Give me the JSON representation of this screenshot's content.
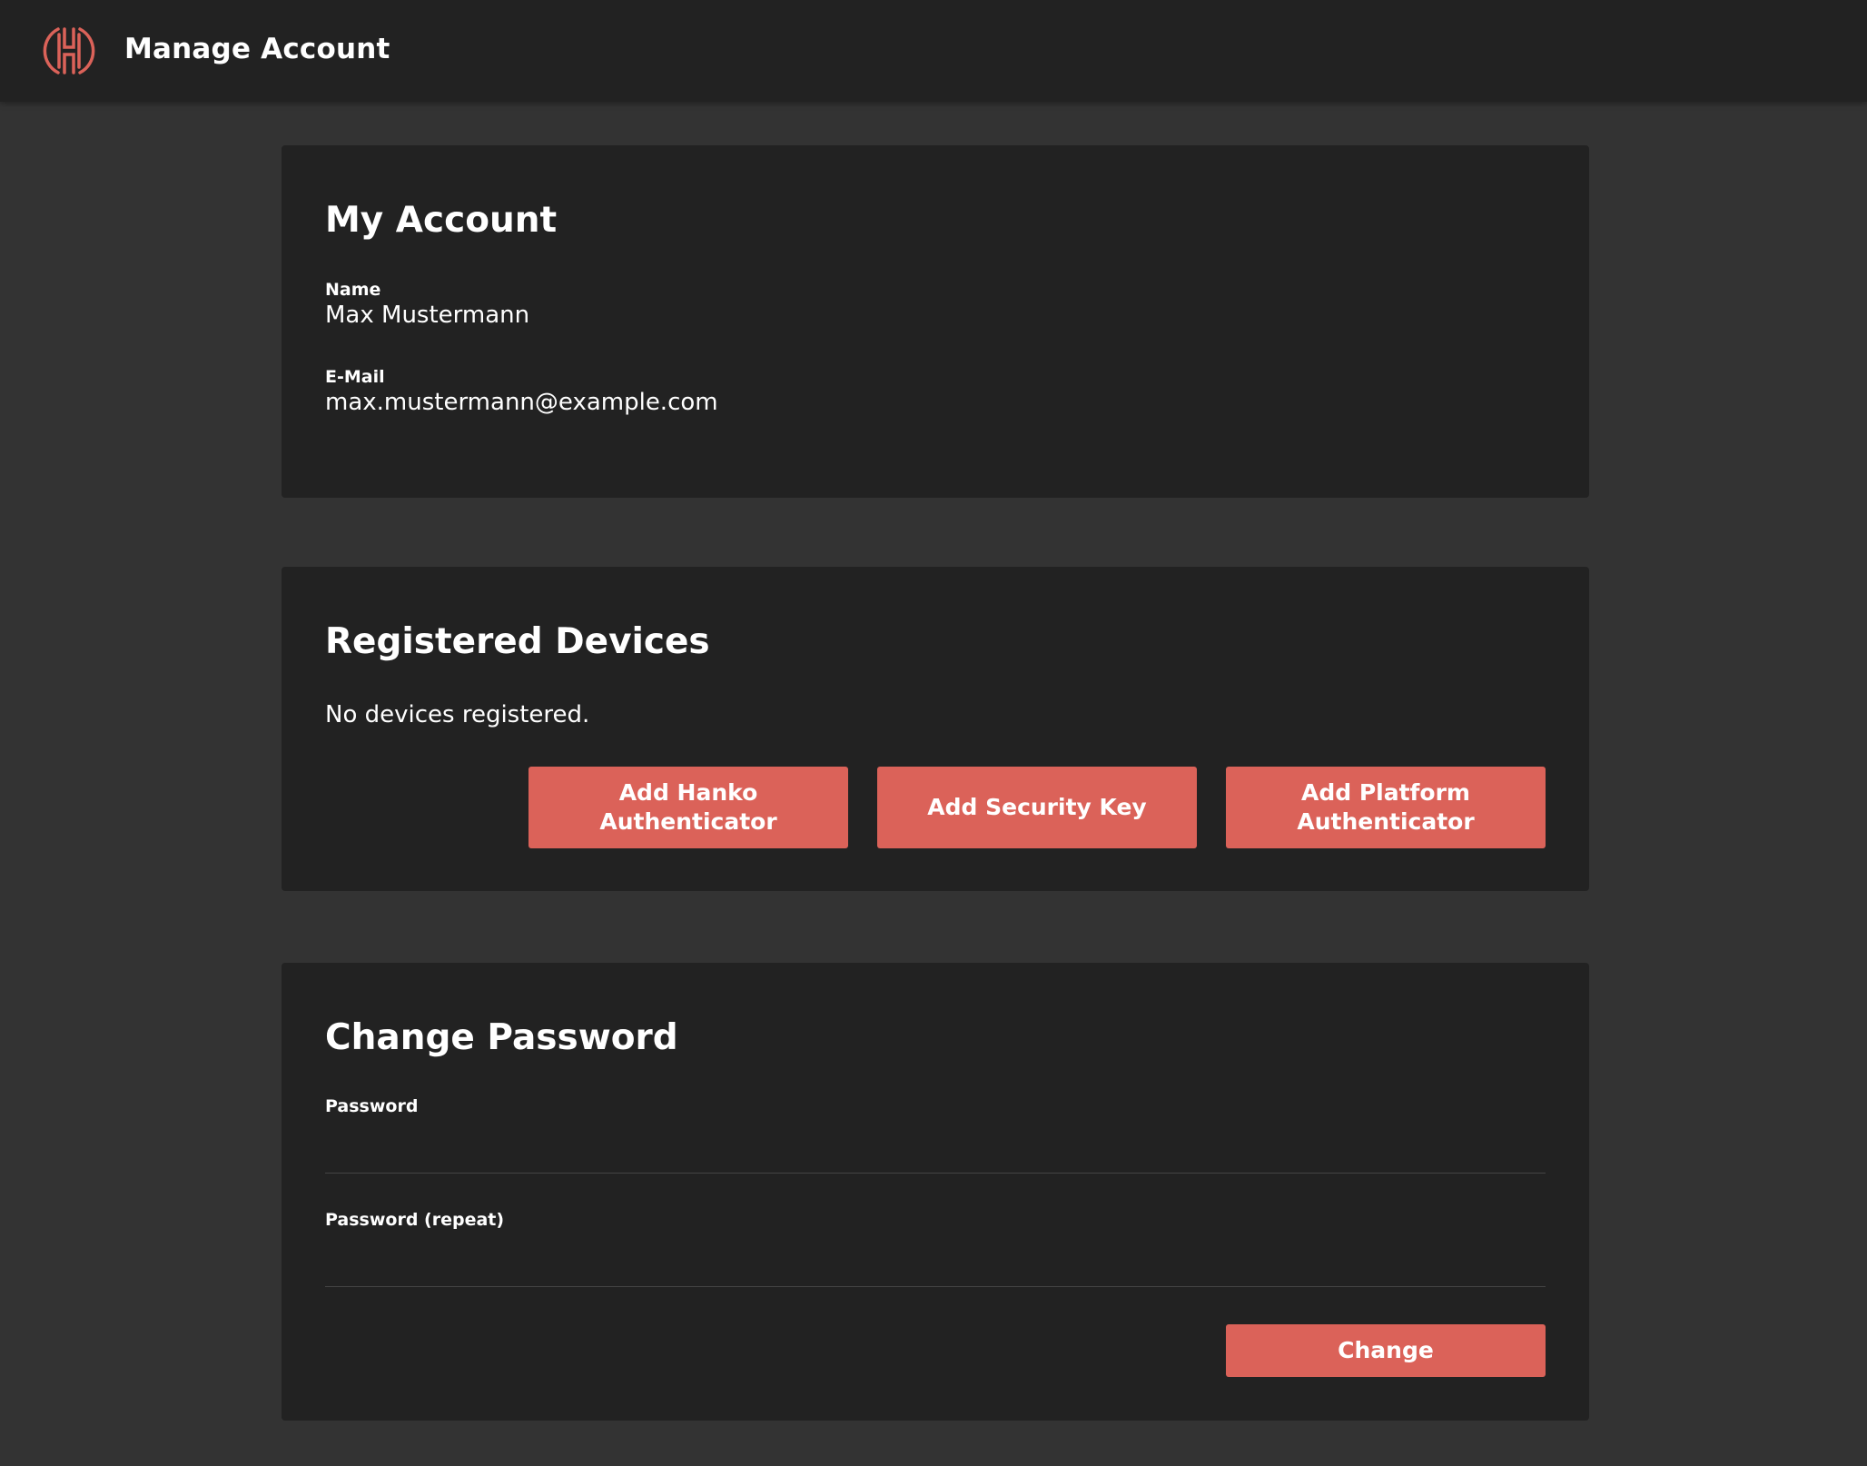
{
  "header": {
    "title": "Manage Account",
    "logo_icon": "hanko-logo-icon",
    "accent_color": "#db6259"
  },
  "account": {
    "heading": "My Account",
    "name_label": "Name",
    "name_value": "Max Mustermann",
    "email_label": "E-Mail",
    "email_value": "max.mustermann@example.com"
  },
  "devices": {
    "heading": "Registered Devices",
    "empty_text": "No devices registered.",
    "buttons": [
      {
        "label": "Add Hanko Authenticator"
      },
      {
        "label": "Add Security Key"
      },
      {
        "label": "Add Platform Authenticator"
      }
    ]
  },
  "password": {
    "heading": "Change Password",
    "password_label": "Password",
    "password_value": "",
    "repeat_label": "Password (repeat)",
    "repeat_value": "",
    "submit_label": "Change"
  }
}
